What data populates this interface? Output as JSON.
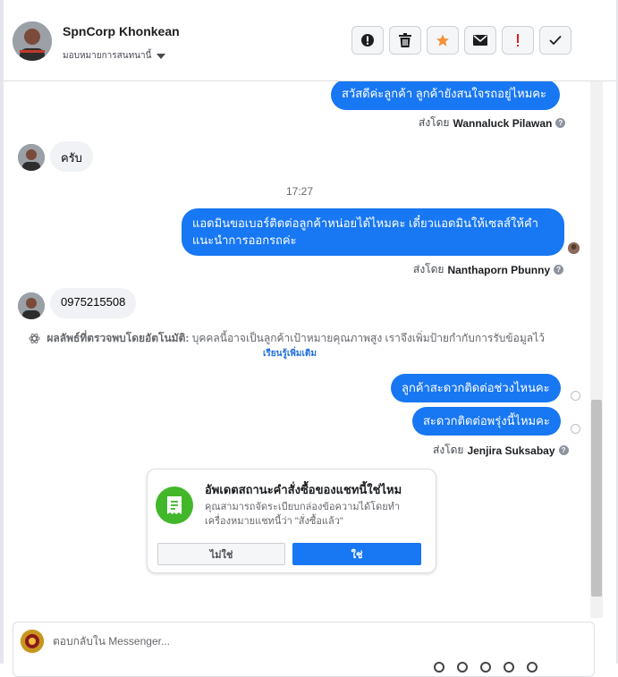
{
  "header": {
    "contact_name": "SpnCorp Khonkean",
    "assign_label": "มอบหมายการสนทนานี้",
    "actions": [
      "exclamation-circle-icon",
      "trash-icon",
      "star-icon",
      "envelope-icon",
      "exclamation-icon",
      "check-icon"
    ]
  },
  "messages": {
    "m1_text": "สวัสดีค่ะลูกค้า ลูกค้ายังสนใจรถอยู่ไหมคะ",
    "m1_sent_prefix": "ส่งโดย",
    "m1_sender": "Wannaluck Pilawan",
    "m2_text": "ครับ",
    "time_1": "17:27",
    "m3_text": "แอดมินขอเบอร์ติดต่อลูกค้าหน่อยได้ไหมคะ เดี๋ยวแอดมินให้เซลส์ให้คำแนะนำการออกรถค่ะ",
    "m3_sent_prefix": "ส่งโดย",
    "m3_sender": "Nanthaporn Pbunny",
    "m4_text": "0975215508",
    "notice_label": "ผลลัพธ์ที่ตรวจพบโดยอัตโนมัติ:",
    "notice_text": "บุคคลนี้อาจเป็นลูกค้าเป้าหมายคุณภาพสูง เราจึงเพิ่มป้ายกำกับการรับข้อมูลไว้",
    "learn_more": "เรียนรู้เพิ่มเติม",
    "m5_text": "ลูกค้าสะดวกติดต่อช่วงไหนคะ",
    "m6_text": "สะดวกติดต่อพรุ่งนี้ไหมคะ",
    "m6_sent_prefix": "ส่งโดย",
    "m6_sender": "Jenjira Suksabay"
  },
  "status_card": {
    "title": "อัพเดตสถานะคำสั่งซื้อของแชทนี้ใช่ไหม",
    "body": "คุณสามารถจัดระเบียบกล่องข้อความได้โดยทำเครื่องหมายแชทนี้ว่า \"สั่งซื้อแล้ว\"",
    "no_label": "ไม่ใช่",
    "yes_label": "ใช่"
  },
  "composer": {
    "placeholder": "ตอบกลับใน Messenger..."
  },
  "colors": {
    "accent": "#1877f2",
    "incoming_bubble": "#f0f2f5",
    "card_icon": "#42b72a",
    "alert_red": "#e02020",
    "star_orange": "#f7923b"
  }
}
